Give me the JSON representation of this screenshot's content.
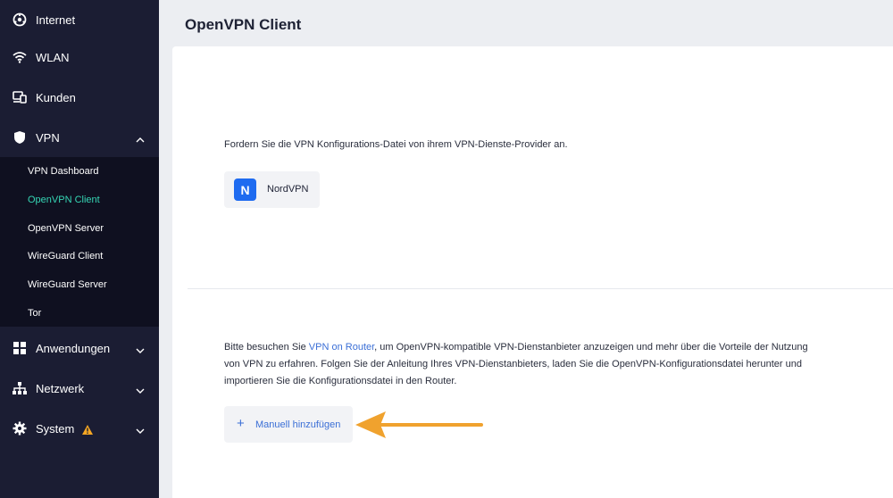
{
  "sidebar": {
    "items": [
      {
        "label": "Internet",
        "icon": "globe-icon"
      },
      {
        "label": "WLAN",
        "icon": "wifi-icon"
      },
      {
        "label": "Kunden",
        "icon": "devices-icon"
      },
      {
        "label": "VPN",
        "icon": "shield-icon"
      },
      {
        "label": "Anwendungen",
        "icon": "apps-grid-icon"
      },
      {
        "label": "Netzwerk",
        "icon": "network-icon"
      },
      {
        "label": "System",
        "icon": "gear-icon"
      }
    ],
    "vpn_subitems": [
      {
        "label": "VPN Dashboard"
      },
      {
        "label": "OpenVPN Client",
        "active": true
      },
      {
        "label": "OpenVPN Server"
      },
      {
        "label": "WireGuard Client"
      },
      {
        "label": "WireGuard Server"
      },
      {
        "label": "Tor"
      }
    ],
    "active_color": "#35d6b4",
    "warning_color": "#f5a623"
  },
  "main": {
    "title": "OpenVPN Client",
    "intro": "Fordern Sie die VPN Konfigurations-Datei von ihrem VPN-Dienste-Provider an.",
    "provider": {
      "logo_letter": "N",
      "name": "NordVPN",
      "logo_color": "#1e6bf0"
    },
    "paragraph": {
      "before": "Bitte besuchen Sie ",
      "link": "VPN on Router",
      "after": ", um OpenVPN-kompatible VPN-Dienstanbieter anzuzeigen und mehr über die Vorteile der Nutzung von VPN zu erfahren. Folgen Sie der Anleitung Ihres VPN-Dienstanbieters, laden Sie die OpenVPN-Konfigurationsdatei herunter und importieren Sie die Konfigurationsdatei in den Router."
    },
    "add_button": {
      "plus": "+",
      "label": "Manuell hinzufügen"
    },
    "annotation_arrow_color": "#f0a22e"
  }
}
